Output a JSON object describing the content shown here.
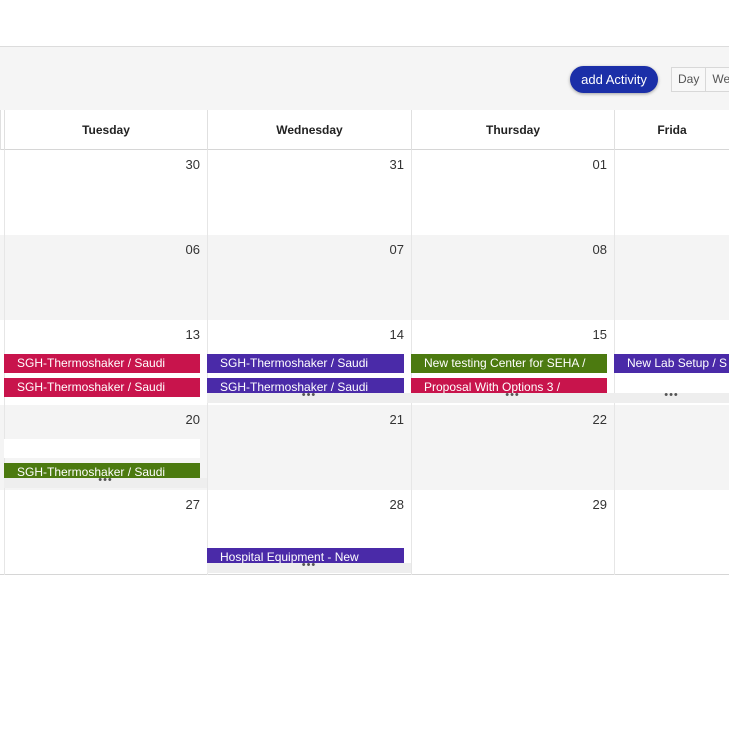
{
  "toolbar": {
    "add_label": "add Activity",
    "views": [
      "Day",
      "We"
    ]
  },
  "calendar": {
    "columns": [
      "Tuesday",
      "Wednesday",
      "Thursday",
      "Frida"
    ],
    "weeks": [
      {
        "dates": [
          "30",
          "31",
          "01",
          ""
        ],
        "events": [],
        "more": []
      },
      {
        "dates": [
          "06",
          "07",
          "08",
          ""
        ],
        "events": [],
        "more": []
      },
      {
        "dates": [
          "13",
          "14",
          "15",
          ""
        ],
        "events": [
          {
            "col": 0,
            "slot": 0,
            "text": "SGH-Thermoshaker / Saudi",
            "color": "red"
          },
          {
            "col": 0,
            "slot": 1,
            "text": "SGH-Thermoshaker / Saudi",
            "color": "red"
          },
          {
            "col": 1,
            "slot": 0,
            "text": "SGH-Thermoshaker / Saudi",
            "color": "purple"
          },
          {
            "col": 1,
            "slot": 1,
            "text": "SGH-Thermoshaker / Saudi",
            "color": "purple"
          },
          {
            "col": 2,
            "slot": 0,
            "text": "New testing Center for SEHA /",
            "color": "green"
          },
          {
            "col": 2,
            "slot": 1,
            "text": "Proposal With Options 3 /",
            "color": "red"
          },
          {
            "col": 3,
            "slot": 0,
            "text": "New Lab Setup / S",
            "color": "purple"
          }
        ],
        "more": [
          1,
          2,
          3
        ]
      },
      {
        "dates": [
          "20",
          "21",
          "22",
          ""
        ],
        "events": [
          {
            "col": 0,
            "slot": 0,
            "text": "",
            "color": "blank"
          },
          {
            "col": 0,
            "slot": 1,
            "text": "SGH-Thermoshaker / Saudi",
            "color": "green"
          }
        ],
        "more": [
          0
        ]
      },
      {
        "dates": [
          "27",
          "28",
          "29",
          ""
        ],
        "events": [
          {
            "col": 1,
            "slot": 1,
            "text": "Hospital Equipment - New",
            "color": "purple"
          }
        ],
        "more": [
          1
        ]
      }
    ],
    "more_label": "•••"
  },
  "colors": {
    "red": "#c8144c",
    "purple": "#4a2aa8",
    "green": "#4c7a10",
    "accent": "#1b2fa8"
  }
}
